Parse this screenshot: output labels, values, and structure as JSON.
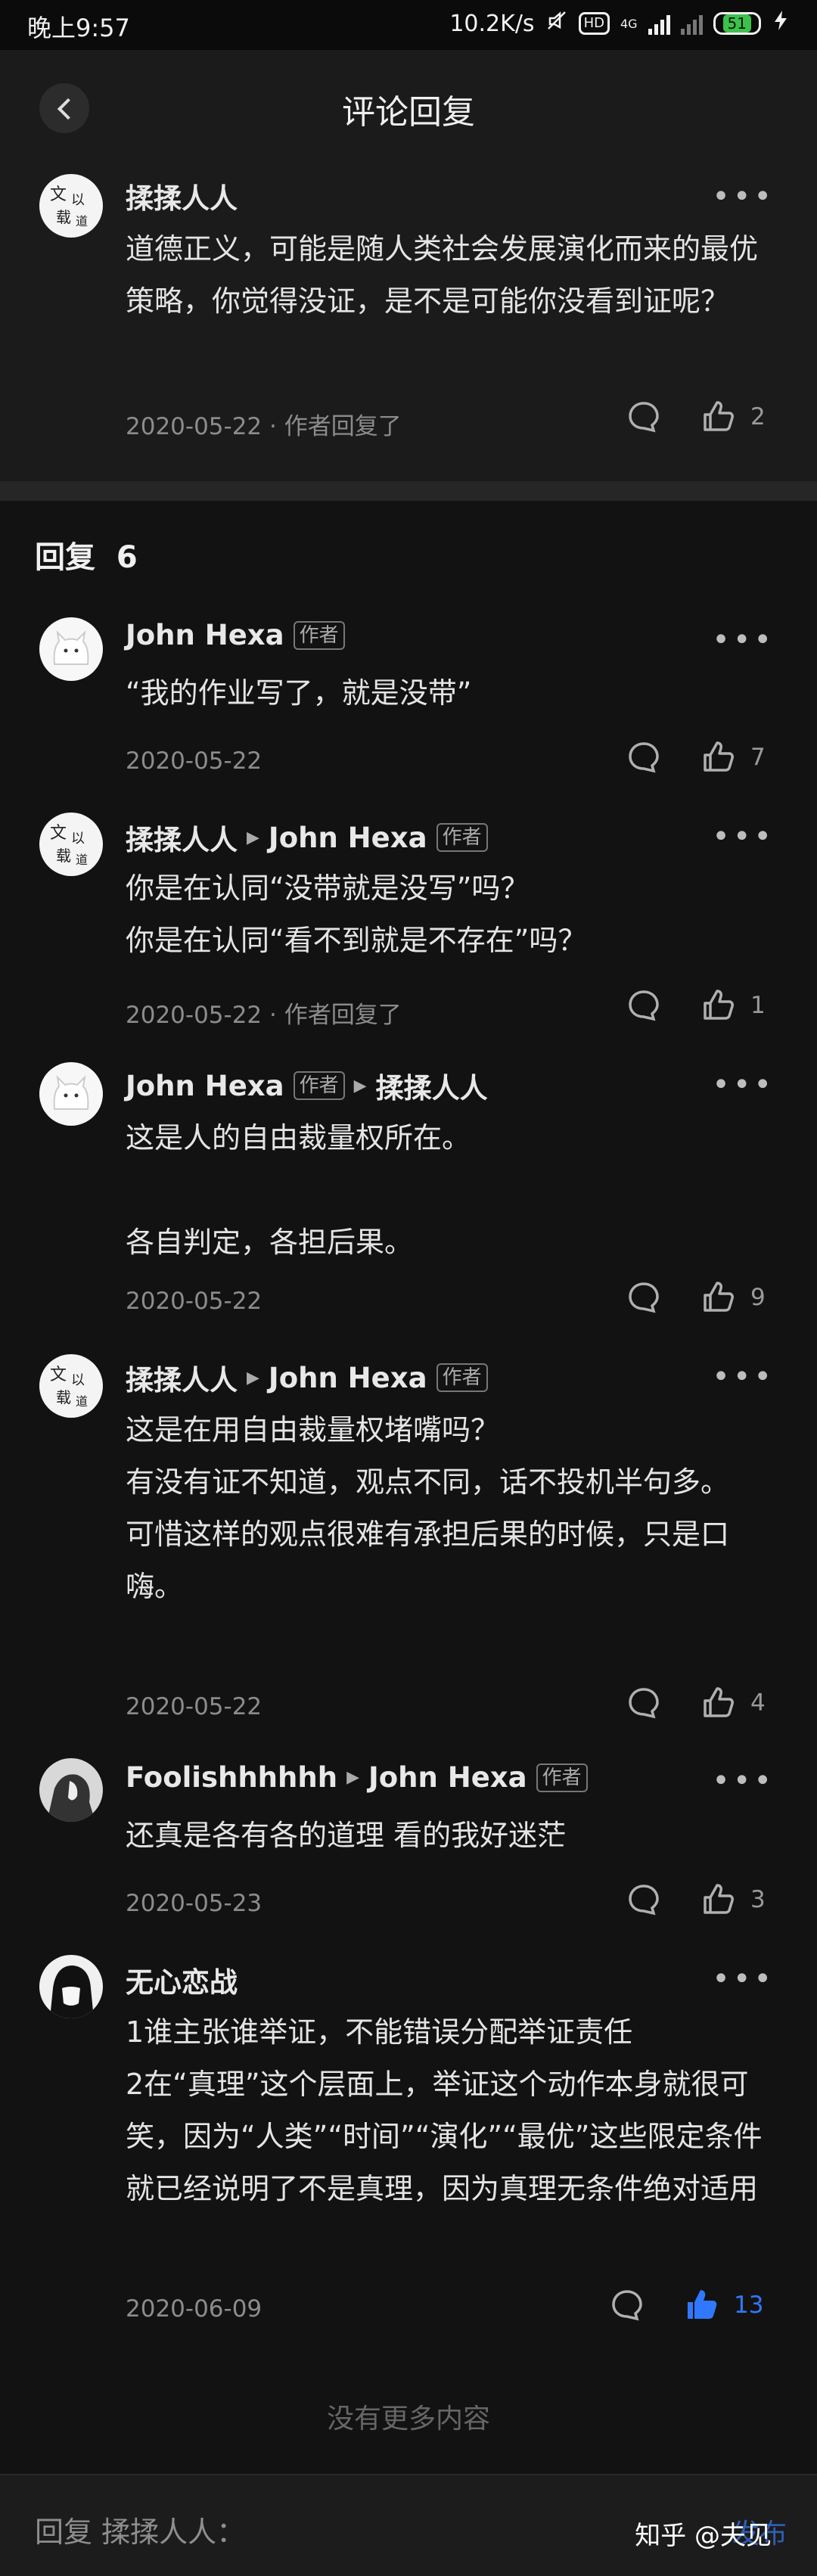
{
  "status_bar": {
    "time": "晚上9:57",
    "speed": "10.2K/s",
    "hd": "HD",
    "network": "4G",
    "battery": "51"
  },
  "header": {
    "title": "评论回复"
  },
  "main_comment": {
    "author": "揉揉人人",
    "text": "道德正义，可能是随人类社会发展演化而来的最优策略，你觉得没证，是不是可能你没看到证呢？",
    "meta": "2020-05-22 · 作者回复了",
    "likes": "2"
  },
  "replies_label": "回复",
  "replies_count": "6",
  "author_badge": "作者",
  "replies": [
    {
      "author": "John Hexa",
      "text": "“我的作业写了，就是没带”",
      "meta": "2020-05-22",
      "likes": "7"
    },
    {
      "author": "揉揉人人",
      "to": "John Hexa",
      "text1": "你是在认同“没带就是没写”吗？",
      "text2": "你是在认同“看不到就是不存在”吗？",
      "meta": "2020-05-22 · 作者回复了",
      "likes": "1"
    },
    {
      "author": "John Hexa",
      "to": "揉揉人人",
      "text1": "这是人的自由裁量权所在。",
      "text2": "各自判定，各担后果。",
      "meta": "2020-05-22",
      "likes": "9"
    },
    {
      "author": "揉揉人人",
      "to": "John Hexa",
      "text1": "这是在用自由裁量权堵嘴吗？",
      "text2": "有没有证不知道，观点不同，话不投机半句多。",
      "text3": "可惜这样的观点很难有承担后果的时候，只是口嗨。",
      "meta": "2020-05-22",
      "likes": "4"
    },
    {
      "author": "Foolishhhhhh",
      "to": "John Hexa",
      "text": "还真是各有各的道理 看的我好迷茫",
      "meta": "2020-05-23",
      "likes": "3"
    },
    {
      "author": "无心恋战",
      "text1": "1谁主张谁举证，不能错误分配举证责任",
      "text2": "2在“真理”这个层面上，举证这个动作本身就很可笑，因为“人类”“时间”“演化”“最优”这些限定条件就已经说明了不是真理，因为真理无条件绝对适用",
      "meta": "2020-06-09",
      "likes": "13"
    }
  ],
  "no_more": "没有更多内容",
  "bottom": {
    "reply_placeholder": "回复 揉揉人人：",
    "send": "发布",
    "watermark": "知乎 @夫见"
  },
  "colors": {
    "liked": "#2f78ff",
    "background": "#121212",
    "card": "#1b1b1b"
  }
}
